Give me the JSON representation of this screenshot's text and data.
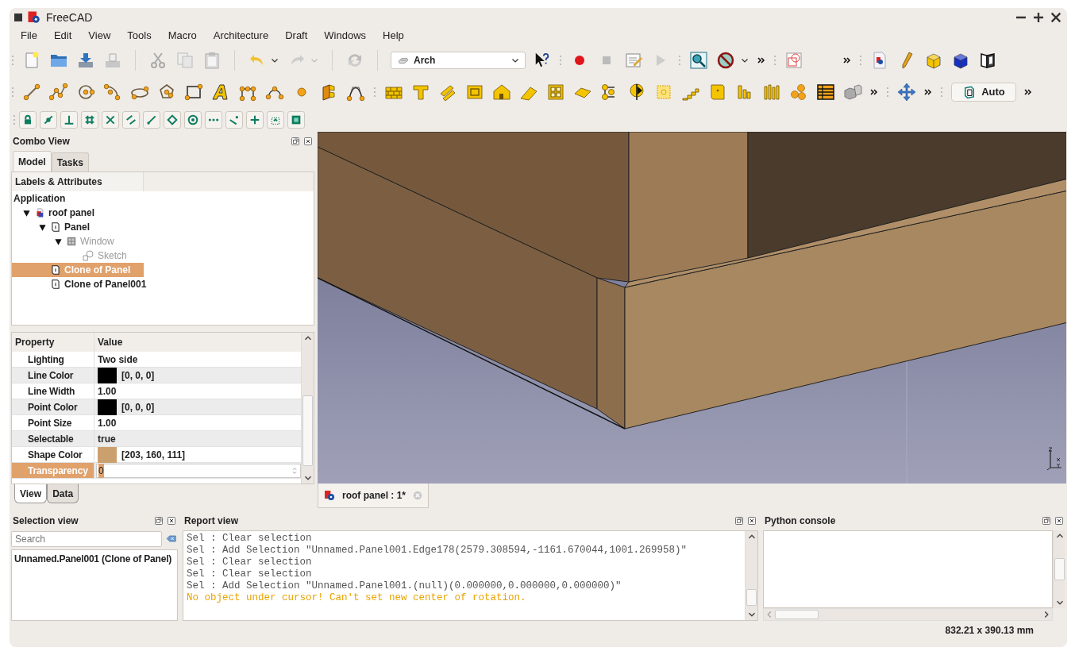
{
  "window": {
    "title": "FreeCAD"
  },
  "menu": [
    "File",
    "Edit",
    "View",
    "Tools",
    "Macro",
    "Architecture",
    "Draft",
    "Windows",
    "Help"
  ],
  "toolbar": {
    "workbench": "Arch",
    "view_mode": "Auto"
  },
  "combo_view": {
    "title": "Combo View",
    "tabs": [
      {
        "label": "Model",
        "selected": true
      },
      {
        "label": "Tasks",
        "selected": false
      }
    ],
    "tree_header": "Labels & Attributes",
    "tree": {
      "label": "Application",
      "children": [
        {
          "label": "roof panel",
          "kind": "document",
          "expanded": true,
          "hidden": false,
          "selected": false,
          "children": [
            {
              "label": "Panel",
              "kind": "panel",
              "expanded": true,
              "hidden": false,
              "selected": false,
              "children": [
                {
                  "label": "Window",
                  "kind": "window",
                  "expanded": true,
                  "hidden": true,
                  "selected": false,
                  "children": [
                    {
                      "label": "Sketch",
                      "kind": "sketch",
                      "hidden": true,
                      "selected": false
                    }
                  ]
                }
              ]
            },
            {
              "label": "Clone of Panel",
              "kind": "panel",
              "hidden": false,
              "selected": true
            },
            {
              "label": "Clone of Panel001",
              "kind": "panel",
              "hidden": false,
              "selected": false
            }
          ]
        }
      ]
    },
    "property_columns": [
      "Property",
      "Value"
    ],
    "properties": [
      {
        "name": "Lighting",
        "value": "Two side",
        "kind": "text",
        "selected": false
      },
      {
        "name": "Line Color",
        "value": "[0, 0, 0]",
        "kind": "color",
        "color": "#000000",
        "selected": false
      },
      {
        "name": "Line Width",
        "value": "1.00",
        "kind": "text",
        "selected": false
      },
      {
        "name": "Point Color",
        "value": "[0, 0, 0]",
        "kind": "color",
        "color": "#000000",
        "selected": false
      },
      {
        "name": "Point Size",
        "value": "1.00",
        "kind": "text",
        "selected": false
      },
      {
        "name": "Selectable",
        "value": "true",
        "kind": "text",
        "selected": false
      },
      {
        "name": "Shape Color",
        "value": "[203, 160, 111]",
        "kind": "color",
        "color": "#cba06f",
        "selected": false
      },
      {
        "name": "Transparency",
        "value": "0",
        "kind": "input",
        "selected": true
      }
    ],
    "property_tabs": [
      {
        "label": "View",
        "selected": true
      },
      {
        "label": "Data",
        "selected": false
      }
    ]
  },
  "viewport_tab": {
    "label": "roof panel : 1*"
  },
  "selection_view": {
    "title": "Selection view",
    "search_placeholder": "Search",
    "items": [
      "Unnamed.Panel001 (Clone of Panel)"
    ]
  },
  "report_view": {
    "title": "Report view",
    "lines": [
      {
        "text": "Sel : Clear selection",
        "kind": "log"
      },
      {
        "text": "Sel : Add Selection \"Unnamed.Panel001.Edge178(2579.308594,-1161.670044,1001.269958)\"",
        "kind": "log"
      },
      {
        "text": "Sel : Clear selection",
        "kind": "log"
      },
      {
        "text": "Sel : Clear selection",
        "kind": "log"
      },
      {
        "text": "Sel : Add Selection \"Unnamed.Panel001.(null)(0.000000,0.000000,0.000000)\"",
        "kind": "log"
      },
      {
        "text": "No object under cursor! Can't set new center of rotation.",
        "kind": "warning"
      }
    ]
  },
  "python_console": {
    "title": "Python console"
  },
  "status_bar": {
    "dimensions": "832.21 x 390.13 mm"
  }
}
